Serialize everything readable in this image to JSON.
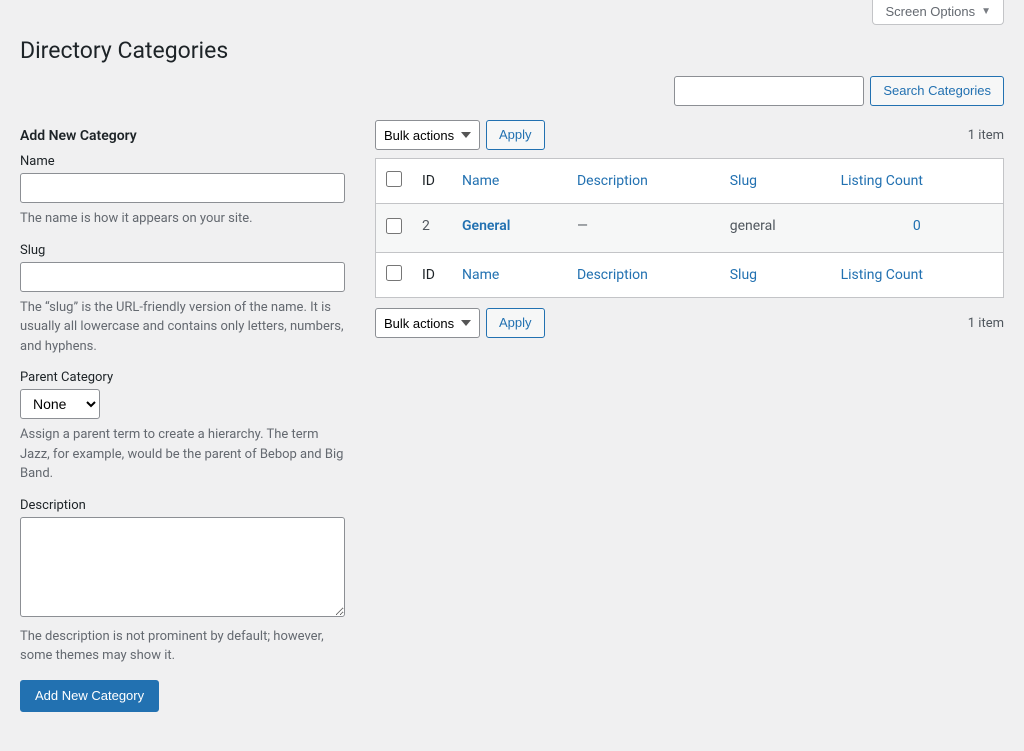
{
  "screen_options": "Screen Options",
  "page_title": "Directory Categories",
  "search": {
    "button": "Search Categories"
  },
  "form": {
    "heading": "Add New Category",
    "name": {
      "label": "Name",
      "value": "",
      "desc": "The name is how it appears on your site."
    },
    "slug": {
      "label": "Slug",
      "value": "",
      "desc": "The “slug” is the URL-friendly version of the name. It is usually all lowercase and contains only letters, numbers, and hyphens."
    },
    "parent": {
      "label": "Parent Category",
      "selected": "None",
      "desc": "Assign a parent term to create a hierarchy. The term Jazz, for example, would be the parent of Bebop and Big Band."
    },
    "description": {
      "label": "Description",
      "value": "",
      "desc": "The description is not prominent by default; however, some themes may show it."
    },
    "submit": "Add New Category"
  },
  "bulk": {
    "label": "Bulk actions",
    "apply": "Apply"
  },
  "pagination": {
    "count": "1 item"
  },
  "columns": {
    "id": "ID",
    "name": "Name",
    "description": "Description",
    "slug": "Slug",
    "count": "Listing Count"
  },
  "rows": [
    {
      "id": "2",
      "name": "General",
      "description": "—",
      "slug": "general",
      "count": "0"
    }
  ]
}
